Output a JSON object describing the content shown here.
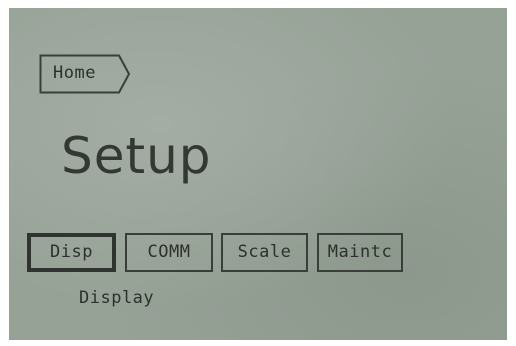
{
  "breadcrumb": {
    "label": "Home"
  },
  "page": {
    "title": "Setup"
  },
  "tabs": [
    {
      "label": "Disp",
      "selected": true
    },
    {
      "label": "COMM",
      "selected": false
    },
    {
      "label": "Scale",
      "selected": false
    },
    {
      "label": "Maintc",
      "selected": false
    }
  ],
  "selected_tab_description": "Display",
  "colors": {
    "lcd_background": "#97a297",
    "lcd_foreground": "#2d302d"
  }
}
